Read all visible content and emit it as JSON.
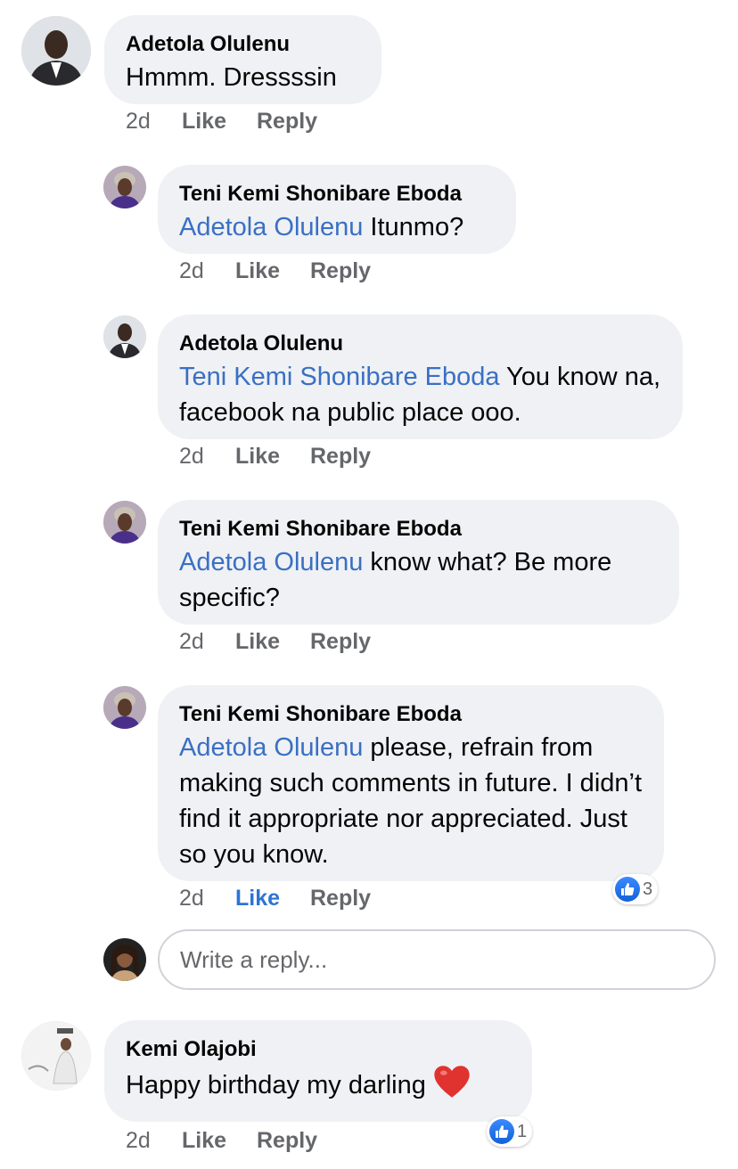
{
  "comments": [
    {
      "author": "Adetola Olulenu",
      "mention": "",
      "text": "Hmmm. Dressssin",
      "time": "2d",
      "like": "Like",
      "reply": "Reply"
    },
    {
      "author": "Teni Kemi Shonibare Eboda",
      "mention": "Adetola Olulenu",
      "text": " Itunmo?",
      "time": "2d",
      "like": "Like",
      "reply": "Reply"
    },
    {
      "author": "Adetola Olulenu",
      "mention": "Teni Kemi Shonibare Eboda",
      "text": " You know na, facebook na public place ooo.",
      "time": "2d",
      "like": "Like",
      "reply": "Reply"
    },
    {
      "author": "Teni Kemi Shonibare Eboda",
      "mention": "Adetola Olulenu",
      "text": " know what? Be more specific?",
      "time": "2d",
      "like": "Like",
      "reply": "Reply"
    },
    {
      "author": "Teni Kemi Shonibare Eboda",
      "mention": "Adetola Olulenu",
      "text": " please, refrain from making such comments in future. I didn’t find it appropriate nor appreciated. Just so you know.",
      "time": "2d",
      "like": "Like",
      "reply": "Reply",
      "reaction_count": "3"
    },
    {
      "author": "Kemi Olajobi",
      "mention": "",
      "text": "Happy birthday my darling",
      "time": "2d",
      "like": "Like",
      "reply": "Reply",
      "reaction_count": "1"
    }
  ],
  "reply_box": {
    "placeholder": "Write a reply..."
  },
  "colors": {
    "mention": "#3a6fc4",
    "liked": "#2d73d6",
    "bubble": "#eff1f4"
  },
  "icons": {
    "reaction": "thumbs-up-icon",
    "emoji": "red-heart-icon"
  }
}
